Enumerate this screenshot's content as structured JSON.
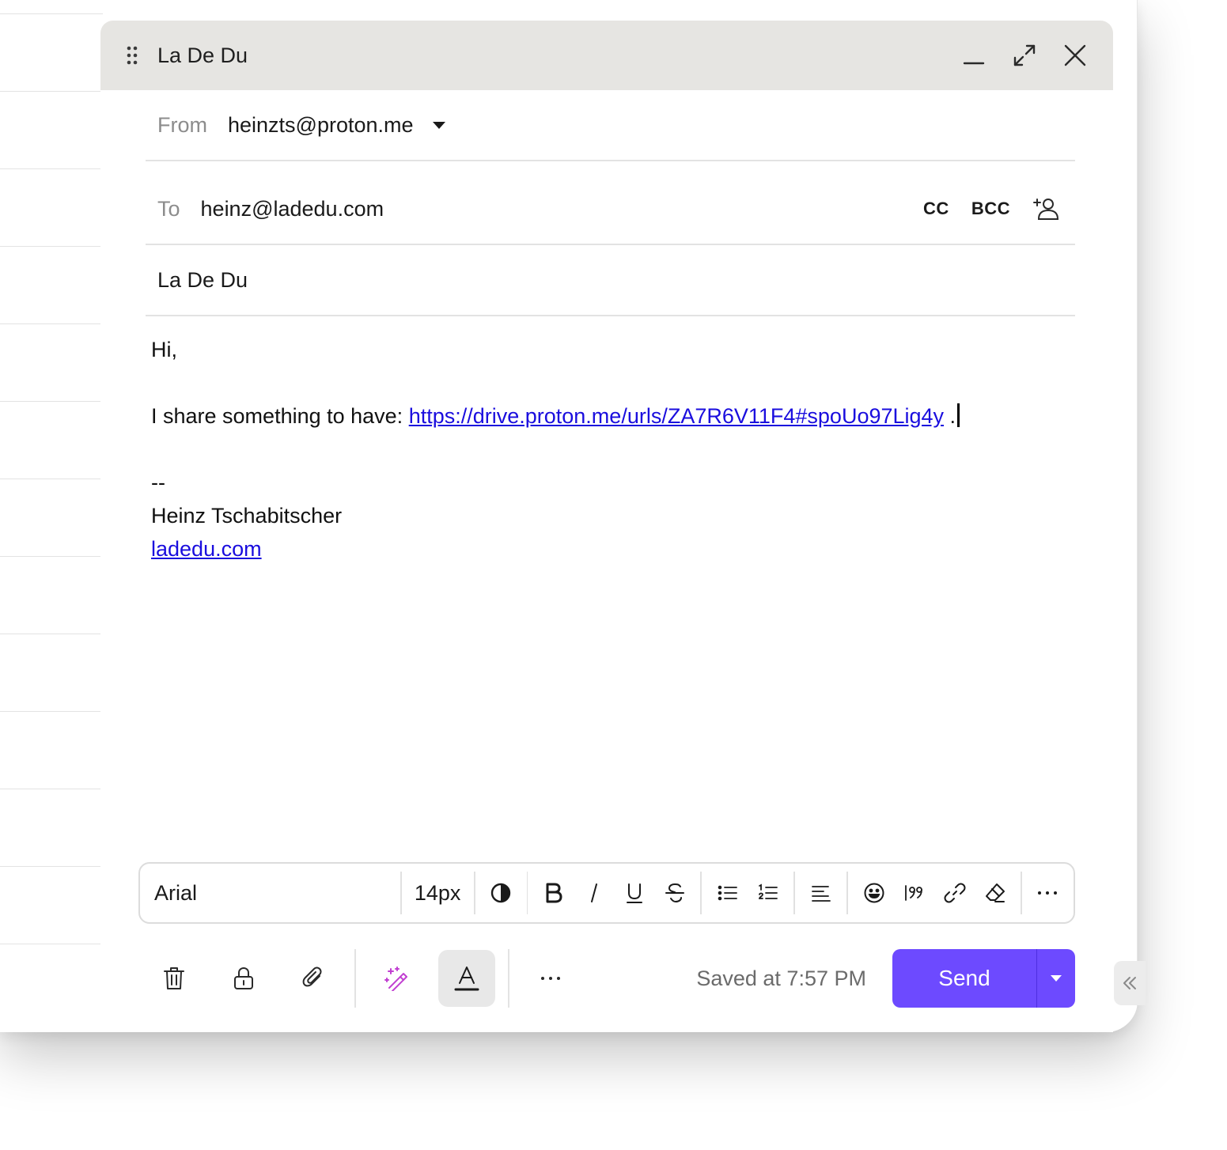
{
  "composer": {
    "title": "La De Du",
    "from_label": "From",
    "from_value": "heinzts@proton.me",
    "to_label": "To",
    "to_value": "heinz@ladedu.com",
    "cc_label": "CC",
    "bcc_label": "BCC",
    "subject": "La De Du",
    "body": {
      "greeting": "Hi,",
      "line_prefix": "I share something to have: ",
      "link": "https://drive.proton.me/urls/ZA7R6V11F4#spoUo97Lig4y",
      "line_suffix": " .",
      "sig_dash": "--",
      "sig_name": "Heinz Tschabitscher",
      "sig_link": "ladedu.com"
    }
  },
  "format_bar": {
    "font": "Arial",
    "size": "14px"
  },
  "footer": {
    "saved_text": "Saved at 7:57 PM",
    "send_label": "Send"
  },
  "colors": {
    "accent": "#6d4aff",
    "titlebar": "#e6e5e2",
    "link": "#1a0dde",
    "assistant_icon": "#c13fd1"
  }
}
